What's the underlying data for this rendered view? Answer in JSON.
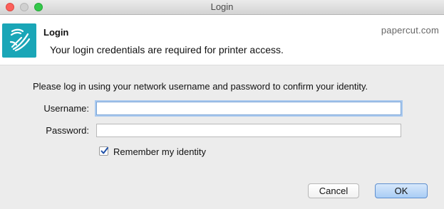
{
  "window": {
    "title": "Login"
  },
  "banner": {
    "title": "Login",
    "subtitle": "Your login credentials are required for printer access.",
    "brand": "papercut.com",
    "logo_color": "#1aa6b7"
  },
  "form": {
    "instructions": "Please log in using your network username and password to confirm your identity.",
    "username_label": "Username:",
    "username_value": "",
    "password_label": "Password:",
    "password_value": "",
    "remember_label": "Remember my identity",
    "remember_checked": true
  },
  "buttons": {
    "cancel": "Cancel",
    "ok": "OK"
  },
  "colors": {
    "close": "#fc605b",
    "minimize": "#d0d0d0",
    "maximize": "#34c84a",
    "focus_ring": "#a9c9ef"
  }
}
